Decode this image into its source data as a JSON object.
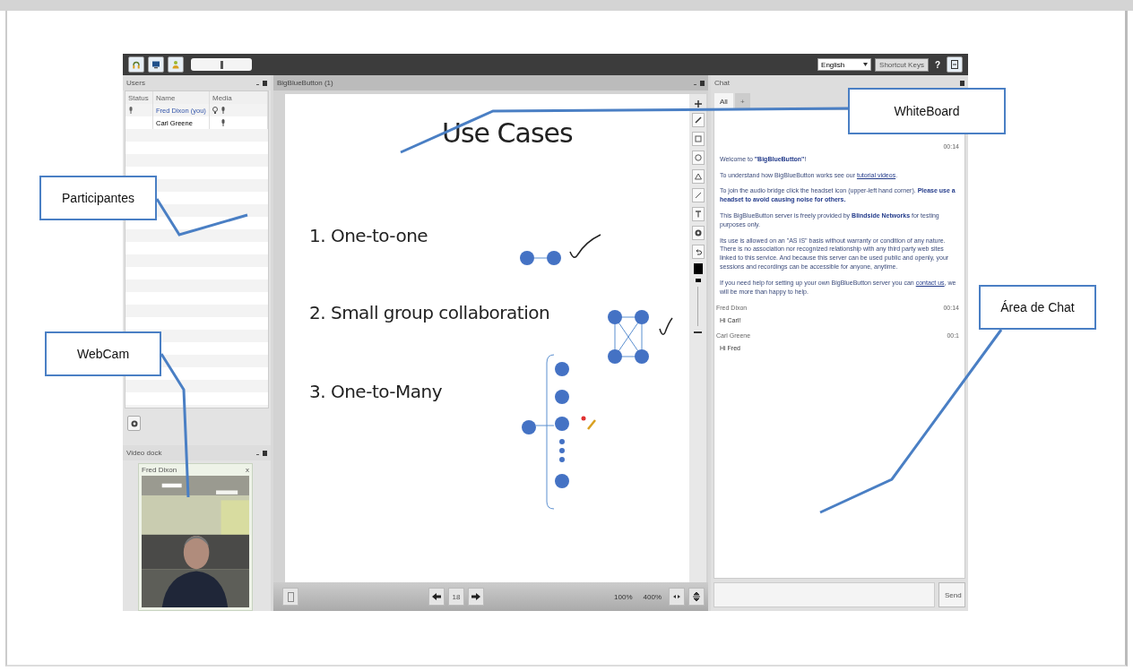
{
  "topbar": {
    "volume": {
      "level": 0.5
    },
    "language": "English",
    "shortcut_button": "Shortcut Keys",
    "help_button": "?"
  },
  "users": {
    "title": "Users",
    "columns": [
      "Status",
      "Name",
      "Media"
    ],
    "rows": [
      {
        "name": "Fred Dixon (you)",
        "presenter": true,
        "webcam": true
      },
      {
        "name": "Carl Greene",
        "presenter": false,
        "webcam": false
      }
    ]
  },
  "video_dock": {
    "title": "Video dock",
    "window_title": "Fred Dixon",
    "close": "x"
  },
  "whiteboard": {
    "title": "BigBlueButton (1)",
    "slide_title": "Use Cases",
    "items": [
      "1. One-to-one",
      "2. Small group collaboration",
      "3. One-to-Many"
    ],
    "page": "18",
    "zoom_min": "100%",
    "zoom_max": "400%"
  },
  "chat": {
    "title": "Chat",
    "tabs": [
      {
        "label": "All",
        "selected": true
      },
      {
        "label": "+",
        "selected": false
      }
    ],
    "welcome_time": "00:14",
    "welcome": [
      [
        {
          "kind": "text",
          "text": "Welcome to "
        },
        {
          "kind": "bold",
          "text": "\"BigBlueButton\""
        },
        {
          "kind": "text",
          "text": "!"
        }
      ],
      [
        {
          "kind": "text",
          "text": "To understand how BigBlueButton works see our "
        },
        {
          "kind": "link",
          "text": "tutorial videos"
        },
        {
          "kind": "text",
          "text": "."
        }
      ],
      [
        {
          "kind": "text",
          "text": "To join the audio bridge click the headset icon (upper-left hand corner). "
        },
        {
          "kind": "bold",
          "text": "Please use a headset to avoid causing noise for others."
        }
      ],
      [
        {
          "kind": "text",
          "text": "This BigBlueButton server is freely provided by "
        },
        {
          "kind": "bold",
          "text": "Blindside Networks"
        },
        {
          "kind": "text",
          "text": " for testing purposes only."
        }
      ],
      [
        {
          "kind": "text",
          "text": "Its use is allowed on an \"AS IS\" basis without warranty or condition of any nature. There is no association nor recognized relationship with any third party web sites linked to this service. And because this server can be used public and openly, your sessions and recordings can be accessible for anyone, anytime."
        }
      ],
      [
        {
          "kind": "text",
          "text": "If you need help for setting up your own BigBlueButton server you can "
        },
        {
          "kind": "link",
          "text": "contact us"
        },
        {
          "kind": "text",
          "text": ", we will be more than happy to help."
        }
      ]
    ],
    "messages": [
      {
        "sender": "Fred Dixon",
        "time": "00:14",
        "text": "Hi Carl!"
      },
      {
        "sender": "Carl Greene",
        "time": "00:1",
        "text": "Hi Fred"
      }
    ],
    "send_button": "Send"
  },
  "callouts": [
    {
      "label": "WhiteBoard"
    },
    {
      "label": "Participantes"
    },
    {
      "label": "WebCam"
    },
    {
      "label": "Área de Chat"
    }
  ]
}
